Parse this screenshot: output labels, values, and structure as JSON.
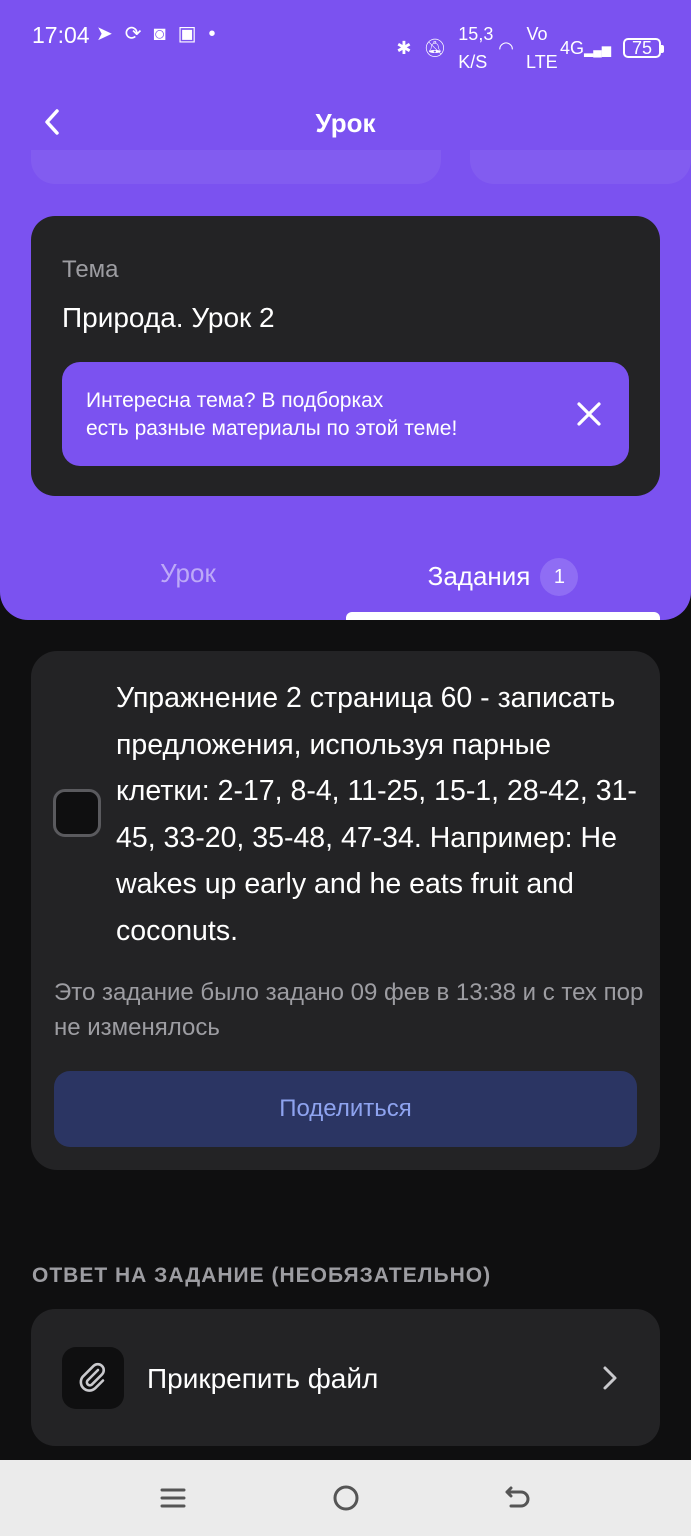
{
  "status_bar": {
    "time": "17:04",
    "net_speed_value": "15,3",
    "net_speed_unit": "K/S",
    "volte_top": "Vo",
    "volte_bottom": "LTE",
    "signal_label": "4G",
    "battery": "75"
  },
  "header": {
    "title": "Урок"
  },
  "topic": {
    "label": "Тема",
    "value": "Природа. Урок 2",
    "promo_line1": "Интересна тема? В подборках",
    "promo_line2": "есть разные материалы по этой теме!"
  },
  "tabs": {
    "lesson_label": "Урок",
    "tasks_label": "Задания",
    "tasks_count": "1"
  },
  "task": {
    "text": "Упражнение 2 страница 60 - записать предложения, используя парные клетки: 2-17, 8-4, 11-25, 15-1, 28-42, 31-45, 33-20, 35-48, 47-34. Например: He wakes up early and he eats fruit and coconuts.",
    "note": "Это задание было задано 09 фев в 13:38 и с тех пор не изменялось",
    "share_label": "Поделиться"
  },
  "answer": {
    "section_label": "ОТВЕТ НА ЗАДАНИЕ (НЕОБЯЗАТЕЛЬНО)",
    "attach_label": "Прикрепить файл"
  },
  "colors": {
    "accent": "#7b52f0",
    "card": "#232325",
    "background": "#0f0f10",
    "share_button": "#2b3563",
    "share_text": "#8ea3ef"
  },
  "icons": {
    "back": "chevron-left-icon",
    "close": "close-icon",
    "attach": "paperclip-icon",
    "chevron": "chevron-right-icon"
  }
}
